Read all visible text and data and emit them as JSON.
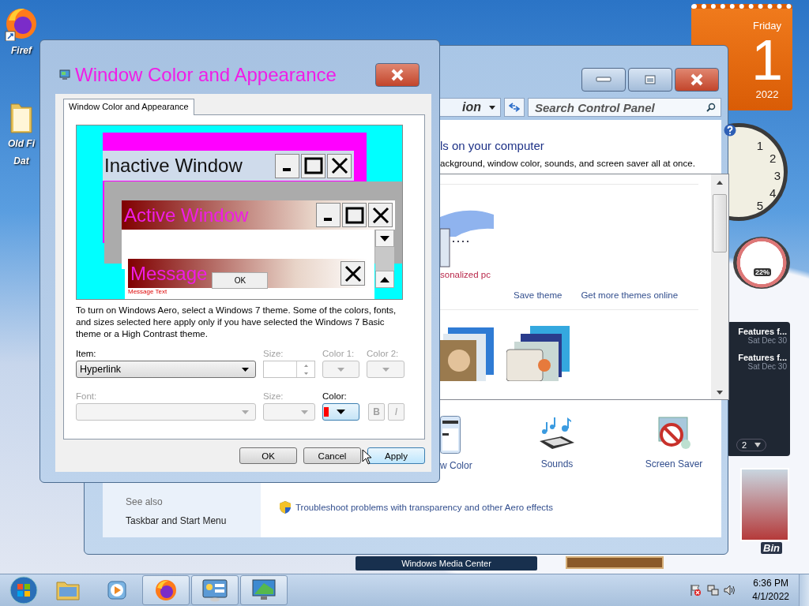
{
  "desktop_icons": [
    {
      "kind": "browser",
      "lines": [
        "Firef"
      ]
    },
    {
      "kind": "folder",
      "lines": [
        "Old Fi",
        "Dat"
      ]
    }
  ],
  "recycle_bin": {
    "label": "Bin"
  },
  "calendar_gadget": {
    "weekday": "Friday",
    "day": "1",
    "year": "2022"
  },
  "clock_gadget": {
    "numbers": [
      "1",
      "2",
      "3",
      "4",
      "5"
    ]
  },
  "cpu_gadget": {
    "reading": "22%"
  },
  "feed_gadget": {
    "items": [
      {
        "title": "Features f...",
        "date": "Sat Dec 30"
      },
      {
        "title": "Features f...",
        "date": "Sat Dec 30"
      }
    ],
    "page": "2"
  },
  "media_center_gadget": {
    "label": "Windows Media Center"
  },
  "control_panel": {
    "address": "ion",
    "search": {
      "placeholder": "Search Control Panel"
    },
    "heading": "ls on your computer",
    "subtitle": "ackground, window color, sounds, and screen saver all at once.",
    "theme_name": "sonalized pc",
    "theme_links": [
      "Save theme",
      "Get more themes online"
    ],
    "settings": [
      {
        "kind": "window-color",
        "label": "w Color"
      },
      {
        "kind": "sounds",
        "label": "Sounds"
      },
      {
        "kind": "screen-saver",
        "label": "Screen Saver"
      }
    ],
    "see_also": {
      "heading": "See also",
      "links": [
        "Taskbar and Start Menu"
      ]
    },
    "troubleshoot_link": "Troubleshoot problems with transparency and other Aero effects"
  },
  "dialog": {
    "title": "Window Color and Appearance",
    "tab": {
      "label": "Window Color and Appearance",
      "selected": true
    },
    "preview": {
      "inactive_title": "Inactive Window",
      "active_title": "Active Window",
      "message_title": "Message",
      "ok": "OK",
      "message_text": "Message Text"
    },
    "description": "To turn on Windows Aero, select a Windows 7 theme.  Some of the colors, fonts, and sizes selected here apply only if you have selected the Windows 7 Basic theme or a High Contrast theme.",
    "item": {
      "label": "Item:",
      "value": "Hyperlink",
      "disabled": false
    },
    "item_size": {
      "label": "Size:",
      "disabled": true
    },
    "color_1": {
      "label": "Color 1:",
      "disabled": true
    },
    "color_2": {
      "label": "Color 2:",
      "disabled": true
    },
    "font": {
      "label": "Font:",
      "disabled": true
    },
    "font_size": {
      "label": "Size:",
      "disabled": true
    },
    "font_color": {
      "label": "Color:",
      "disabled": false,
      "color": "#ff0000"
    },
    "bold": {
      "label": "B",
      "disabled": true
    },
    "italic": {
      "label": "I",
      "disabled": true
    },
    "buttons": [
      {
        "label": "OK",
        "hovered": false
      },
      {
        "label": "Cancel",
        "hovered": false
      },
      {
        "label": "Apply",
        "hovered": true
      }
    ]
  },
  "taskbar": {
    "items": [
      {
        "kind": "folder",
        "open": false
      },
      {
        "kind": "player",
        "open": false
      },
      {
        "kind": "browser",
        "open": true
      },
      {
        "kind": "control-panel",
        "open": true
      },
      {
        "kind": "display",
        "open": true
      }
    ],
    "time": "6:36 PM",
    "date": "4/1/2022"
  }
}
